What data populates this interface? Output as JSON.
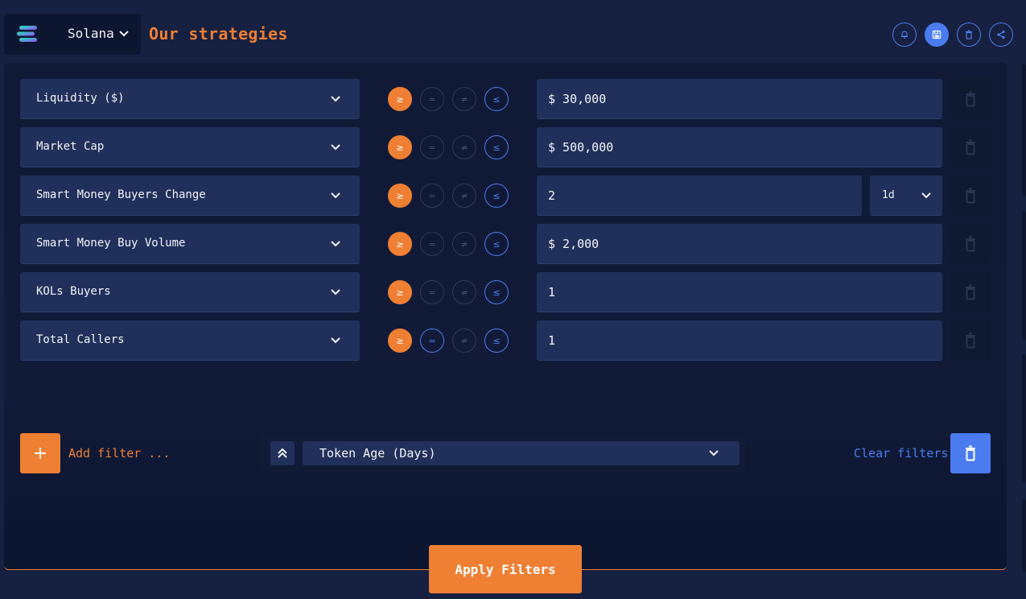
{
  "header": {
    "chain": "Solana",
    "title": "Our strategies",
    "icons": [
      "bell-icon",
      "save-icon",
      "trash-icon",
      "share-icon"
    ]
  },
  "operators": [
    "≥",
    "=",
    "≠",
    "≤"
  ],
  "filters": [
    {
      "field": "Liquidity ($)",
      "value": "$ 30,000",
      "active_ops": [
        "≥",
        "≤"
      ]
    },
    {
      "field": "Market Cap",
      "value": "$ 500,000",
      "active_ops": [
        "≥",
        "≤"
      ]
    },
    {
      "field": "Smart Money Buyers Change",
      "value": "2",
      "period": "1d",
      "active_ops": [
        "≥",
        "≤"
      ]
    },
    {
      "field": "Smart Money Buy Volume",
      "value": "$ 2,000",
      "active_ops": [
        "≥",
        "≤"
      ]
    },
    {
      "field": "KOLs Buyers",
      "value": "1",
      "active_ops": [
        "≥",
        "≤"
      ]
    },
    {
      "field": "Total Callers",
      "value": "1",
      "active_ops": [
        "≥",
        "=",
        "≤"
      ]
    }
  ],
  "footer": {
    "add_label": "Add filter ...",
    "preset": "Token Age (Days)",
    "clear_label": "Clear filters",
    "apply_label": "Apply Filters"
  },
  "colors": {
    "accent": "#ef7f33",
    "primary": "#4a7cf0",
    "background": "#162040",
    "panel": "#101a36",
    "field": "#21305a"
  }
}
